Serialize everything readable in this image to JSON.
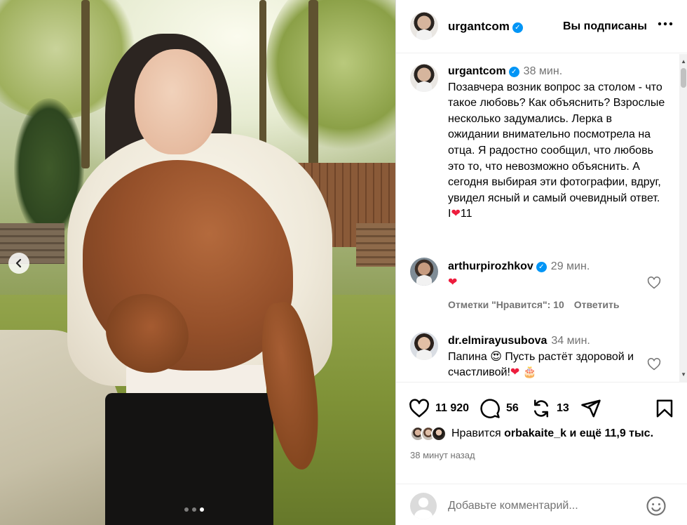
{
  "post": {
    "author": "urgantcom",
    "follow_status": "Вы подписаны",
    "images": {
      "count": 3,
      "active_index": 2
    },
    "caption": {
      "time": "38 мин.",
      "text": "Позавчера возник вопрос за столом - что такое любовь? Как объяснить? Взрослые несколько задумались. Лерка в ожидании внимательно посмотрела на отца. Я радостно сообщил, что любовь это то, что невозможно объяснить. А сегодня выбирая эти фотографии, вдруг, увидел ясный и самый очевидный ответ. I",
      "after_heart": "11"
    },
    "comments": [
      {
        "user": "arthurpirozhkov",
        "verified": true,
        "time": "29 мин.",
        "text": "",
        "emoji": "❤",
        "likes_label": "Отметки \"Нравится\": 10",
        "reply_label": "Ответить"
      },
      {
        "user": "dr.elmirayusubova",
        "verified": false,
        "time": "34 мин.",
        "text_a": "Папина",
        "emoji_a": "😍",
        "text_b": "Пусть растёт здоровой и счастливой!",
        "emoji_b": "❤",
        "emoji_c": "🎂"
      }
    ],
    "stats": {
      "likes": "11 920",
      "comments": "56",
      "reposts": "13"
    },
    "liked_by": {
      "prefix": "Нравится",
      "user": "orbakaite_k",
      "suffix": "и ещё 11,9 тыс."
    },
    "timestamp": "38 минут назад",
    "add_comment_placeholder": "Добавьте комментарий..."
  },
  "icons": {
    "more": "more-horizontal-icon",
    "like": "heart-outline-icon",
    "comment": "speech-bubble-icon",
    "repost": "repost-icon",
    "share": "paper-plane-icon",
    "save": "bookmark-icon",
    "emoji": "smiley-icon",
    "prev": "chevron-left-icon"
  },
  "colors": {
    "verified": "#0095f6",
    "secondary_text": "#737373",
    "heart": "#ed1c3d"
  }
}
